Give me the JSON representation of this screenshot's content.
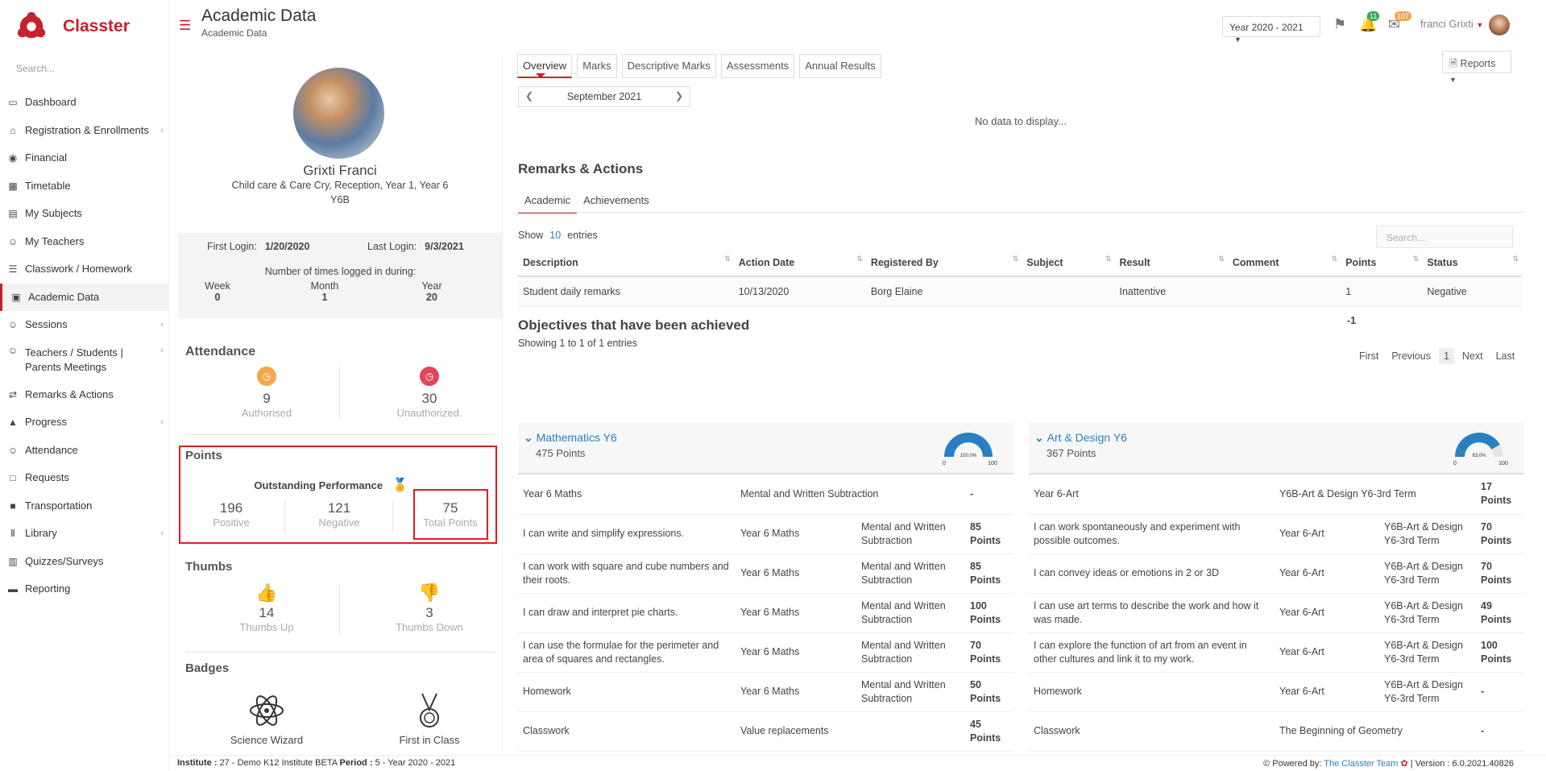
{
  "app": {
    "name": "Classter",
    "search_placeholder": "Search..."
  },
  "sidebar": {
    "items": [
      {
        "label": "Dashboard",
        "icon": "laptop-icon",
        "caret": false
      },
      {
        "label": "Registration & Enrollments",
        "icon": "bank-icon",
        "caret": true
      },
      {
        "label": "Financial",
        "icon": "coins-icon",
        "caret": false
      },
      {
        "label": "Timetable",
        "icon": "calendar-icon",
        "caret": false
      },
      {
        "label": "My Subjects",
        "icon": "book-icon",
        "caret": false
      },
      {
        "label": "My Teachers",
        "icon": "users-icon",
        "caret": false
      },
      {
        "label": "Classwork / Homework",
        "icon": "list-icon",
        "caret": false
      },
      {
        "label": "Academic Data",
        "icon": "id-card-icon",
        "caret": false,
        "active": true
      },
      {
        "label": "Sessions",
        "icon": "users-icon",
        "caret": true
      },
      {
        "label": "Teachers / Students | Parents Meetings",
        "icon": "user-gear-icon",
        "caret": true
      },
      {
        "label": "Remarks & Actions",
        "icon": "shuffle-icon",
        "caret": false
      },
      {
        "label": "Progress",
        "icon": "graduation-cap-icon",
        "caret": true
      },
      {
        "label": "Attendance",
        "icon": "user-check-icon",
        "caret": false
      },
      {
        "label": "Requests",
        "icon": "file-icon",
        "caret": false
      },
      {
        "label": "Transportation",
        "icon": "bus-icon",
        "caret": false
      },
      {
        "label": "Library",
        "icon": "books-icon",
        "caret": true
      },
      {
        "label": "Quizzes/Surveys",
        "icon": "clipboard-icon",
        "caret": false
      },
      {
        "label": "Reporting",
        "icon": "printer-icon",
        "caret": false
      }
    ]
  },
  "header": {
    "title": "Academic Data",
    "breadcrumb": "Academic Data",
    "year": "Year 2020 - 2021",
    "notifications": "11",
    "messages": "107",
    "user": "franci Grixti"
  },
  "profile": {
    "name": "Grixti Franci",
    "classes": "Child care & Care Cry, Reception, Year 1, Year 6",
    "group": "Y6B",
    "first_login_label": "First Login:",
    "first_login": "1/20/2020",
    "last_login_label": "Last Login:",
    "last_login": "9/3/2021",
    "times_label": "Number of times logged in during:",
    "periods": [
      {
        "label": "Week",
        "value": "0"
      },
      {
        "label": "Month",
        "value": "1"
      },
      {
        "label": "Year",
        "value": "20"
      }
    ]
  },
  "attendance": {
    "title": "Attendance",
    "authorised": {
      "value": "9",
      "label": "Authorised",
      "color": "#f0a84b"
    },
    "unauthorized": {
      "value": "30",
      "label": "Unauthorized.",
      "color": "#e0475a"
    }
  },
  "points": {
    "title": "Points",
    "performance": "Outstanding Performance",
    "positive": {
      "value": "196",
      "label": "Positive"
    },
    "negative": {
      "value": "121",
      "label": "Negative"
    },
    "total": {
      "value": "75",
      "label": "Total Points"
    }
  },
  "thumbs": {
    "title": "Thumbs",
    "up": {
      "value": "14",
      "label": "Thumbs Up"
    },
    "down": {
      "value": "3",
      "label": "Thumbs Down"
    }
  },
  "badges": {
    "title": "Badges",
    "items": [
      "Science Wizard",
      "First in Class"
    ]
  },
  "main": {
    "tabs": [
      "Overview",
      "Marks",
      "Descriptive Marks",
      "Assessments",
      "Annual Results"
    ],
    "reports": "Reports",
    "month": "September 2021",
    "no_data": "No data to display...",
    "remarks_title": "Remarks & Actions",
    "remark_tabs": [
      "Academic",
      "Achievements"
    ],
    "show": "Show",
    "entries_count": "10",
    "entries": "entries",
    "search_placeholder": "Search...",
    "columns": [
      "Description",
      "Action Date",
      "Registered By",
      "Subject",
      "Result",
      "Comment",
      "Points",
      "Status"
    ],
    "rows": [
      {
        "description": "Student daily remarks",
        "date": "10/13/2020",
        "registered_by": "Borg Elaine",
        "subject": "",
        "result": "Inattentive",
        "comment": "",
        "points": "1",
        "status": "Negative"
      }
    ],
    "points_total": "-1",
    "showing": "Showing 1 to 1 of 1 entries",
    "pager": [
      "First",
      "Previous",
      "1",
      "Next",
      "Last"
    ],
    "objectives_title": "Objectives that have been achieved"
  },
  "objectives": [
    {
      "title": "Mathematics Y6",
      "points": "475 Points",
      "gauge_label": "100.0%",
      "gauge_fraction": 1.0,
      "gauge_min": "0",
      "gauge_max": "100",
      "rows": [
        {
          "c1": "Year 6 Maths",
          "c2": "Mental and Written Subtraction",
          "c3": "",
          "pts": "-"
        },
        {
          "c1": "I can write and simplify expressions.",
          "c2": "Year 6 Maths",
          "c3": "Mental and Written Subtraction",
          "pts": "85 Points"
        },
        {
          "c1": "I can work with square and cube numbers and their roots.",
          "c2": "Year 6 Maths",
          "c3": "Mental and Written Subtraction",
          "pts": "85 Points"
        },
        {
          "c1": "I can draw and interpret pie charts.",
          "c2": "Year 6 Maths",
          "c3": "Mental and Written Subtraction",
          "pts": "100 Points"
        },
        {
          "c1": "I can use the formulae for the perimeter and area of squares and rectangles.",
          "c2": "Year 6 Maths",
          "c3": "Mental and Written Subtraction",
          "pts": "70 Points"
        },
        {
          "c1": "Homework",
          "c2": "Year 6 Maths",
          "c3": "Mental and Written Subtraction",
          "pts": "50 Points"
        },
        {
          "c1": "Classwork",
          "c2": "Value replacements",
          "c3": "",
          "pts": "45 Points"
        }
      ]
    },
    {
      "title": "Art & Design Y6",
      "points": "367 Points",
      "gauge_label": "83.0%",
      "gauge_fraction": 0.83,
      "gauge_min": "0",
      "gauge_max": "100",
      "rows": [
        {
          "c1": "Year 6-Art",
          "c2": "Y6B-Art & Design Y6-3rd Term",
          "c3": "",
          "pts": "17 Points"
        },
        {
          "c1": "I can work spontaneously and experiment with possible outcomes.",
          "c2": "Year 6-Art",
          "c3": "Y6B-Art & Design Y6-3rd Term",
          "pts": "70 Points"
        },
        {
          "c1": "I can convey ideas or emotions in 2 or 3D",
          "c2": "Year 6-Art",
          "c3": "Y6B-Art & Design Y6-3rd Term",
          "pts": "70 Points"
        },
        {
          "c1": "I can use art terms to describe the work and how it was made.",
          "c2": "Year 6-Art",
          "c3": "Y6B-Art & Design Y6-3rd Term",
          "pts": "49 Points"
        },
        {
          "c1": "I can explore the function of art from an event in other cultures and link it to my work.",
          "c2": "Year 6-Art",
          "c3": "Y6B-Art & Design Y6-3rd Term",
          "pts": "100 Points"
        },
        {
          "c1": "Homework",
          "c2": "Year 6-Art",
          "c3": "Y6B-Art & Design Y6-3rd Term",
          "pts": "-"
        },
        {
          "c1": "Classwork",
          "c2": "The Beginning of Geometry",
          "c3": "",
          "pts": "-"
        }
      ]
    }
  ],
  "footer": {
    "institute_label": "Institute :",
    "institute": "27 - Demo K12 Institute BETA",
    "period_label": "Period :",
    "period": "5 - Year 2020 - 2021",
    "powered": "Powered by:",
    "team": "The Classter Team",
    "version": "| Version : 6.0.2021.40826"
  },
  "colors": {
    "brand": "#c8202c",
    "link": "#2a7fc1",
    "highlight_box": "#e31b23",
    "gauge": "#2a7fc1"
  }
}
